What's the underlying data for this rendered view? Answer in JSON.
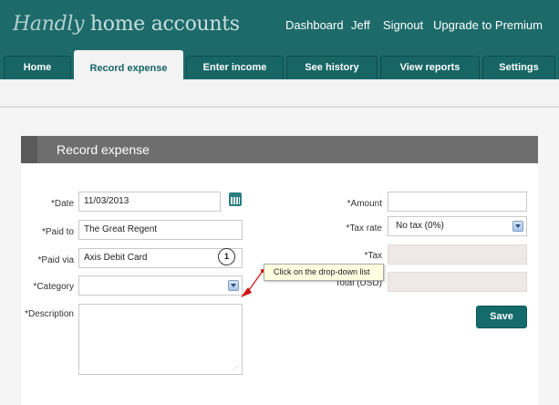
{
  "header": {
    "logo_script": "Handly",
    "logo_text": "home accounts",
    "links": [
      "Dashboard",
      "Jeff",
      "Signout",
      "Upgrade to Premium"
    ]
  },
  "tabs": [
    {
      "label": "Home",
      "active": false
    },
    {
      "label": "Record expense",
      "active": true
    },
    {
      "label": "Enter income",
      "active": false
    },
    {
      "label": "See history",
      "active": false
    },
    {
      "label": "View reports",
      "active": false
    },
    {
      "label": "Settings",
      "active": false
    }
  ],
  "form": {
    "title": "Record expense",
    "date_label": "*Date",
    "date_value": "11/03/2013",
    "paid_to_label": "*Paid to",
    "paid_to_value": "The Great Regent",
    "paid_via_label": "*Paid via",
    "paid_via_value": "Axis Debit Card",
    "category_label": "*Category",
    "category_value": "",
    "description_label": "*Description",
    "description_value": "",
    "amount_label": "*Amount",
    "amount_value": "",
    "tax_rate_label": "*Tax rate",
    "tax_rate_value": "No tax (0%)",
    "tax_label": "*Tax",
    "tax_value": "",
    "total_label": "Total (USD)",
    "total_value": "",
    "save_label": "Save"
  },
  "annotation": {
    "step_number": "1",
    "tooltip_text": "Click on the drop-down list"
  },
  "colors": {
    "brand": "#1d6a6a",
    "save_button": "#156b6b",
    "arrow": "#d01010"
  },
  "icons": [
    "calendar-icon",
    "dropdown-arrow-icon",
    "resize-handle-icon"
  ]
}
